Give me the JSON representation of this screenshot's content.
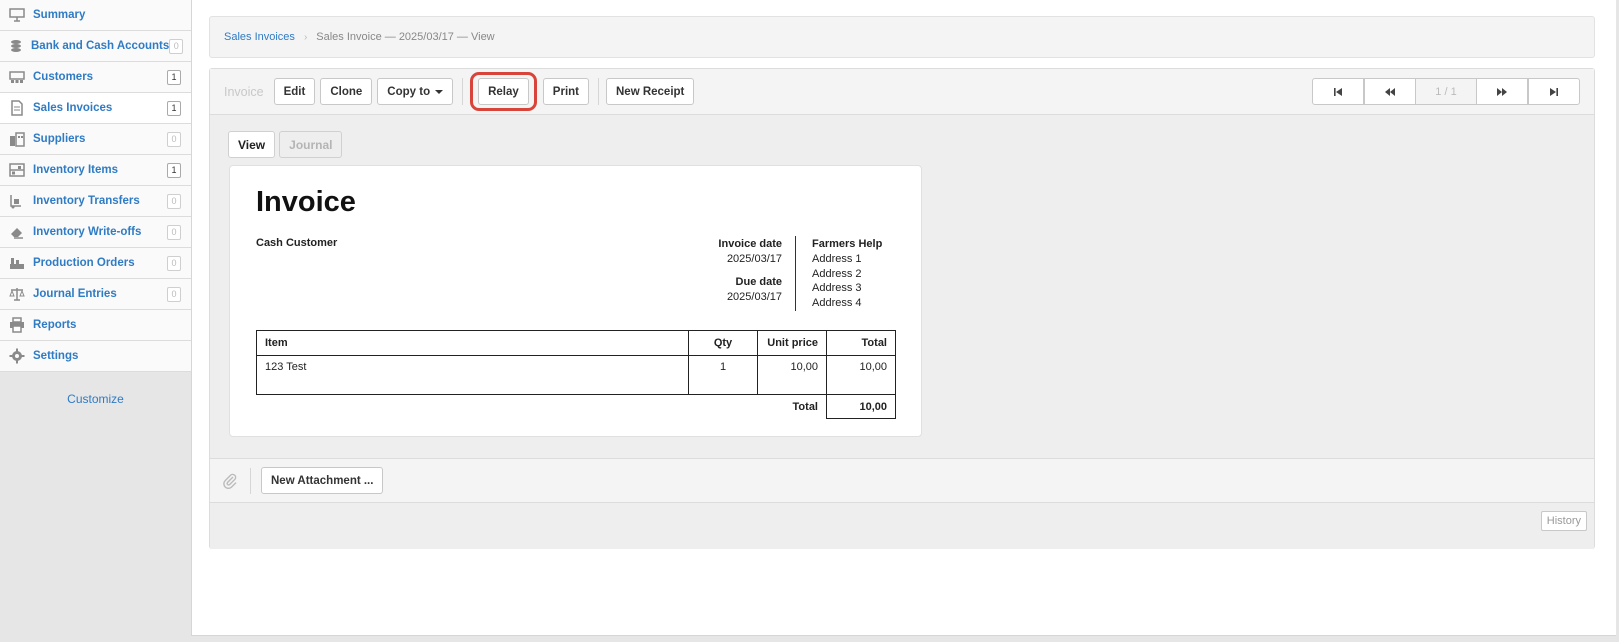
{
  "sidebar": {
    "items": [
      {
        "label": "Summary",
        "icon": "presentation-board-icon",
        "count": ""
      },
      {
        "label": "Bank and Cash Accounts",
        "icon": "coins-icon",
        "count": "0"
      },
      {
        "label": "Customers",
        "icon": "customers-icon",
        "count": "1"
      },
      {
        "label": "Sales Invoices",
        "icon": "invoice-document-icon",
        "count": "1"
      },
      {
        "label": "Suppliers",
        "icon": "buildings-icon",
        "count": "0"
      },
      {
        "label": "Inventory Items",
        "icon": "warehouse-shelf-icon",
        "count": "1"
      },
      {
        "label": "Inventory Transfers",
        "icon": "hand-truck-icon",
        "count": "0"
      },
      {
        "label": "Inventory Write-offs",
        "icon": "eraser-icon",
        "count": "0"
      },
      {
        "label": "Production Orders",
        "icon": "factory-icon",
        "count": "0"
      },
      {
        "label": "Journal Entries",
        "icon": "balance-scale-icon",
        "count": "0"
      },
      {
        "label": "Reports",
        "icon": "printer-icon",
        "count": ""
      },
      {
        "label": "Settings",
        "icon": "gear-icon",
        "count": ""
      }
    ],
    "active_index": 3,
    "customize_label": "Customize"
  },
  "breadcrumb": {
    "parent": "Sales Invoices",
    "current": "Sales Invoice — 2025/03/17 — View"
  },
  "toolbar": {
    "title": "Invoice",
    "edit": "Edit",
    "clone": "Clone",
    "copy_to": "Copy to",
    "relay": "Relay",
    "print": "Print",
    "new_receipt": "New Receipt",
    "pager_info": "1 / 1"
  },
  "tabs": {
    "view": "View",
    "journal": "Journal"
  },
  "invoice": {
    "heading": "Invoice",
    "customer": "Cash Customer",
    "invoice_date_label": "Invoice date",
    "invoice_date": "2025/03/17",
    "due_date_label": "Due date",
    "due_date": "2025/03/17",
    "company": {
      "name": "Farmers Help",
      "address": [
        "Address 1",
        "Address 2",
        "Address 3",
        "Address 4"
      ]
    },
    "columns": {
      "item": "Item",
      "qty": "Qty",
      "unit_price": "Unit price",
      "total": "Total"
    },
    "lines": [
      {
        "item": "123 Test",
        "qty": "1",
        "unit_price": "10,00",
        "total": "10,00"
      }
    ],
    "total_label": "Total",
    "total_value": "10,00"
  },
  "attachments": {
    "new_attachment": "New Attachment ..."
  },
  "history_label": "History",
  "colors": {
    "link": "#2f7bc4",
    "highlight_ring": "#d9443a"
  }
}
